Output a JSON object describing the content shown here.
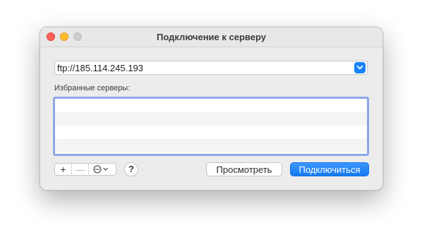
{
  "window": {
    "title": "Подключение к серверу"
  },
  "server": {
    "address_value": "ftp://185.114.245.193"
  },
  "favorites": {
    "label": "Избранные серверы:",
    "rows": [
      "",
      "",
      "",
      ""
    ]
  },
  "toolbar": {
    "add_label": "+",
    "remove_label": "—",
    "help_label": "?"
  },
  "buttons": {
    "browse_label": "Просмотреть",
    "connect_label": "Подключиться"
  },
  "colors": {
    "accent": "#1a82f7",
    "close": "#fe5f57",
    "minimize": "#febc2e",
    "zoom_inactive": "#cfcfcf"
  },
  "icons": {
    "combo": "chevron-down-icon",
    "more": "ellipsis-circle-icon"
  }
}
